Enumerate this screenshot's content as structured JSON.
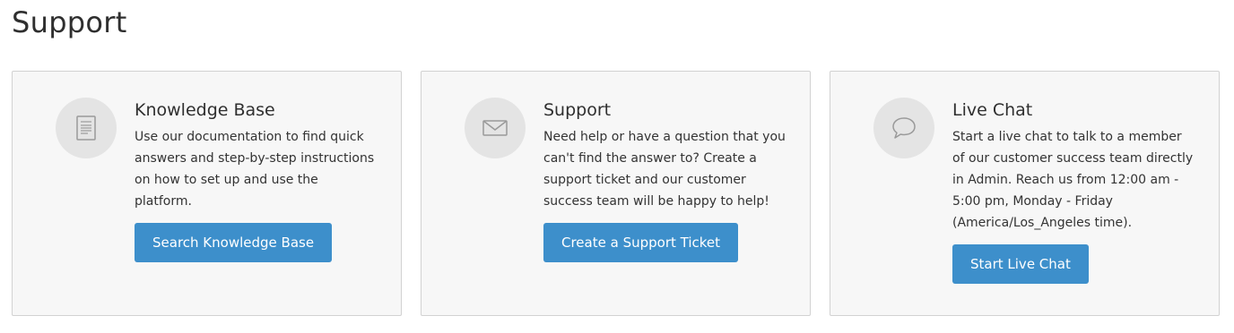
{
  "page": {
    "title": "Support"
  },
  "cards": [
    {
      "icon": "document-icon",
      "title": "Knowledge Base",
      "description": "Use our documentation to find quick answers and step-by-step instructions on how to set up and use the platform.",
      "button_label": "Search Knowledge Base"
    },
    {
      "icon": "envelope-icon",
      "title": "Support",
      "description": "Need help or have a question that you can't find the answer to? Create a support ticket and our customer success team will be happy to help!",
      "button_label": "Create a Support Ticket"
    },
    {
      "icon": "chat-bubble-icon",
      "title": "Live Chat",
      "description": "Start a live chat to talk to a member of our customer success team directly in Admin. Reach us from 12:00 am - 5:00 pm, Monday - Friday (America/Los_Angeles time).",
      "button_label": "Start Live Chat"
    }
  ],
  "colors": {
    "accent": "#3d8fcb",
    "card_background": "#f7f7f7",
    "icon_circle": "#e4e4e4",
    "icon_stroke": "#9a9a9a"
  }
}
